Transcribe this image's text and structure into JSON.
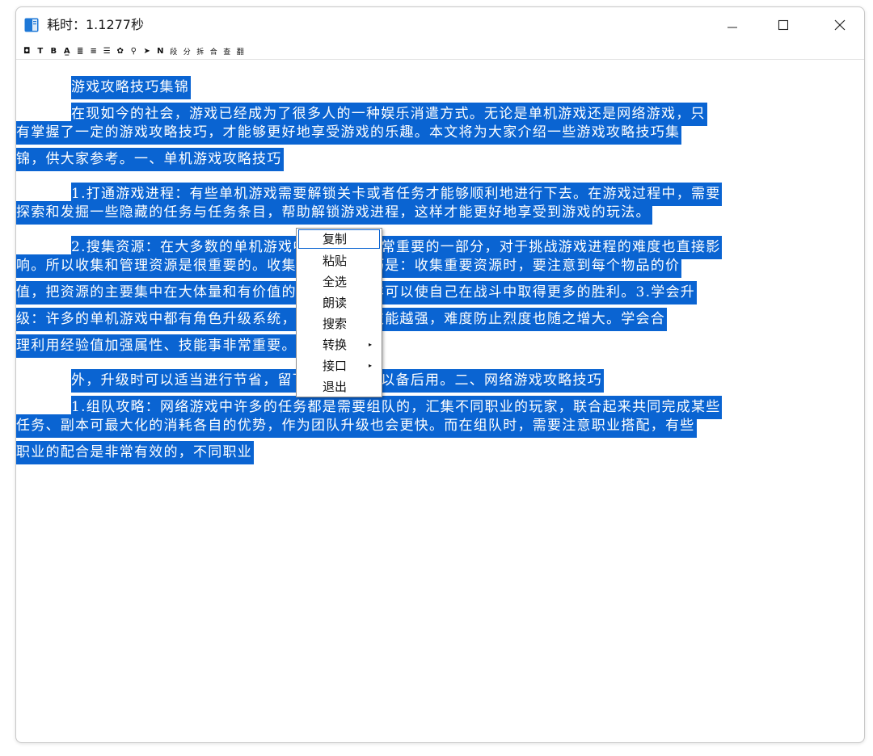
{
  "window": {
    "title": "耗时：1.1277秒"
  },
  "toolbar": {
    "buttons": [
      {
        "name": "square-tool",
        "glyph": "◘"
      },
      {
        "name": "text-tool",
        "glyph": "T"
      },
      {
        "name": "bold-tool",
        "glyph": "B"
      },
      {
        "name": "underline-color-tool",
        "glyph": "A̲"
      },
      {
        "name": "align-left-tool",
        "glyph": "≣"
      },
      {
        "name": "align-center-tool",
        "glyph": "≡"
      },
      {
        "name": "align-justify-tool",
        "glyph": "☰"
      },
      {
        "name": "color-palette-tool",
        "glyph": "✿"
      },
      {
        "name": "search-tool",
        "glyph": "⚲"
      },
      {
        "name": "send-tool",
        "glyph": "➤"
      },
      {
        "name": "normal-tool",
        "glyph": "N"
      },
      {
        "name": "paragraph-tool",
        "glyph": "段"
      },
      {
        "name": "split-tool",
        "glyph": "分"
      },
      {
        "name": "break-tool",
        "glyph": "拆"
      },
      {
        "name": "merge-tool",
        "glyph": "合"
      },
      {
        "name": "check-tool",
        "glyph": "查"
      },
      {
        "name": "translate-tool",
        "glyph": "翻"
      }
    ]
  },
  "document": {
    "lines": [
      "游戏攻略技巧集锦",
      "在现如今的社会，游戏已经成为了很多人的一种娱乐消遣方式。无论是单机游戏还是网络游戏，只",
      "有掌握了一定的游戏攻略技巧，才能够更好地享受游戏的乐趣。本文将为大家介绍一些游戏攻略技巧集",
      "锦，供大家参考。一、单机游戏攻略技巧",
      "1.打通游戏进程：有些单机游戏需要解锁关卡或者任务才能够顺利地进行下去。在游戏过程中，需要",
      "探索和发掘一些隐藏的任务与任务条目，帮助解锁游戏进程，这样才能更好地享受到游戏的玩法。",
      "2.搜集资源：在大多数的单机游戏中，资源是非常重要的一部分，对于挑战游戏进程的难度也直接影",
      "响。所以收集和管理资源是很重要的。收集资源的小技巧是：收集重要资源时，要注意到每个物品的价",
      "值，把资源的主要集中在大体量和有价值的地方上，这样可以使自己在战斗中取得更多的胜利。3.学会升",
      "级：许多的单机游戏中都有角色升级系统，等级越高，技能越强，难度防止烈度也随之增大。学会合",
      "理利用经验值加强属性、技能事非常重要。此",
      "外，升级时可以适当进行节省，留下一些经验值以备后用。二、网络游戏攻略技巧",
      "1.组队攻略：网络游戏中许多的任务都是需要组队的，汇集不同职业的玩家，联合起来共同完成某些",
      "任务、副本可最大化的消耗各自的优势，作为团队升级也会更快。而在组队时，需要注意职业搭配，有些",
      "职业的配合是非常有效的，不同职业"
    ]
  },
  "context_menu": {
    "items": [
      {
        "label": "复制",
        "submenu": false
      },
      {
        "label": "粘贴",
        "submenu": false
      },
      {
        "label": "全选",
        "submenu": false
      },
      {
        "label": "朗读",
        "submenu": false
      },
      {
        "label": "搜索",
        "submenu": false
      },
      {
        "label": "转换",
        "submenu": true
      },
      {
        "label": "接口",
        "submenu": true
      },
      {
        "label": "退出",
        "submenu": false
      }
    ],
    "submenu_arrow": "▸"
  },
  "colors": {
    "selection": "#0a64d2",
    "app_icon": "#1e78d7"
  }
}
